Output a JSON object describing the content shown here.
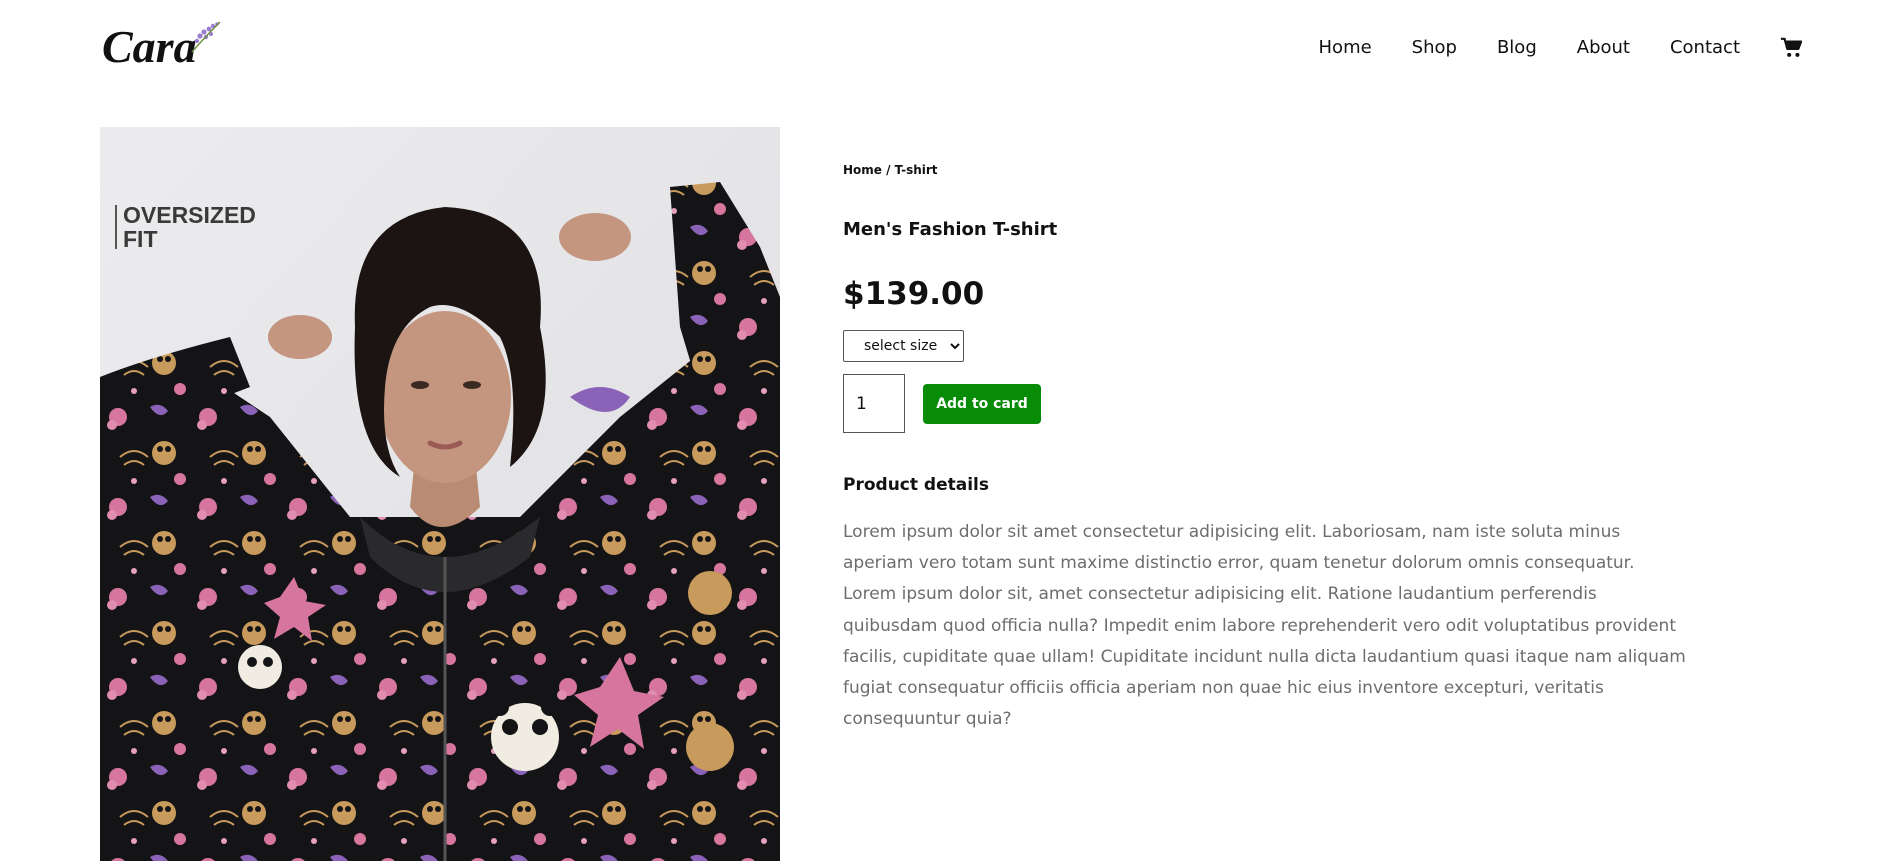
{
  "brand": {
    "logo_text": "Cara"
  },
  "nav": {
    "items": [
      "Home",
      "Shop",
      "Blog",
      "About",
      "Contact"
    ],
    "cart_icon": "shopping-cart-icon"
  },
  "product_image": {
    "badge_line1": "OVERSIZED",
    "badge_line2": "FIT"
  },
  "product": {
    "breadcrumb": "Home / T-shirt",
    "title": "Men's Fashion T-shirt",
    "price": "$139.00",
    "size_select": {
      "selected": "select size"
    },
    "quantity": "1",
    "add_button": "Add to card",
    "details_heading": "Product details",
    "details_text": "Lorem ipsum dolor sit amet consectetur adipisicing elit. Laboriosam, nam iste soluta minus aperiam vero totam sunt maxime distinctio error, quam tenetur dolorum omnis consequatur. Lorem ipsum dolor sit, amet consectetur adipisicing elit. Ratione laudantium perferendis quibusdam quod officia nulla? Impedit enim labore reprehenderit vero odit voluptatibus provident facilis, cupiditate quae ullam! Cupiditate incidunt nulla dicta laudantium quasi itaque nam aliquam fugiat consequatur officiis officia aperiam non quae hic eius inventore excepturi, veritatis consequuntur quia?"
  },
  "colors": {
    "accent_green": "#088c08",
    "text_dark": "#111111",
    "text_muted": "#6d6d6d",
    "image_bg": "#e8e8ea",
    "logo_lavender": "#9b7fcf"
  }
}
